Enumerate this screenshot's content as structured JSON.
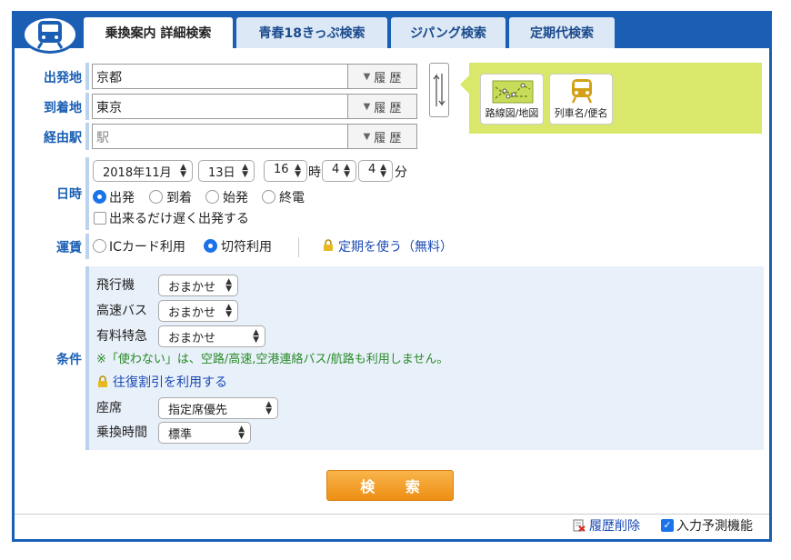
{
  "tabs": [
    {
      "label": "乗換案内 詳細検索"
    },
    {
      "label": "青春18きっぷ検索"
    },
    {
      "label": "ジパング検索"
    },
    {
      "label": "定期代検索"
    }
  ],
  "stations": {
    "from_label": "出発地",
    "from_value": "京都",
    "to_label": "到着地",
    "to_value": "東京",
    "via_label": "経由駅",
    "via_placeholder": "駅",
    "history_label": "履 歴"
  },
  "tools": {
    "map_label": "路線図/地図",
    "train_label": "列車名/便名"
  },
  "datetime": {
    "label": "日時",
    "year_month": "2018年11月",
    "day": "13日",
    "hour": "16",
    "hour_unit": "時",
    "min_tens": "4",
    "min_ones": "4",
    "min_unit": "分",
    "options": [
      "出発",
      "到着",
      "始発",
      "終電"
    ],
    "selected": "出発",
    "late_departure": "出来るだけ遅く出発する"
  },
  "fare": {
    "label": "運賃",
    "options": [
      "ICカード利用",
      "切符利用"
    ],
    "selected": "切符利用",
    "pass_link": "定期を使う（無料）"
  },
  "conditions": {
    "label": "条件",
    "airplane_label": "飛行機",
    "airplane_value": "おまかせ",
    "bus_label": "高速バス",
    "bus_value": "おまかせ",
    "express_label": "有料特急",
    "express_value": "おまかせ",
    "notice": "※「使わない」は、空路/高速,空港連絡バス/航路も利用しません。",
    "roundtrip_link": "往復割引を利用する",
    "seat_label": "座席",
    "seat_value": "指定席優先",
    "transfer_label": "乗換時間",
    "transfer_value": "標準"
  },
  "search_button": "検 索",
  "footer": {
    "clear_history": "履歴削除",
    "predictive_input": "入力予測機能"
  },
  "colors": {
    "brand_blue": "#1a5fb4",
    "search_orange": "#f0a030",
    "tool_green": "#d9e86a",
    "notice_green": "#2a8a2a"
  }
}
